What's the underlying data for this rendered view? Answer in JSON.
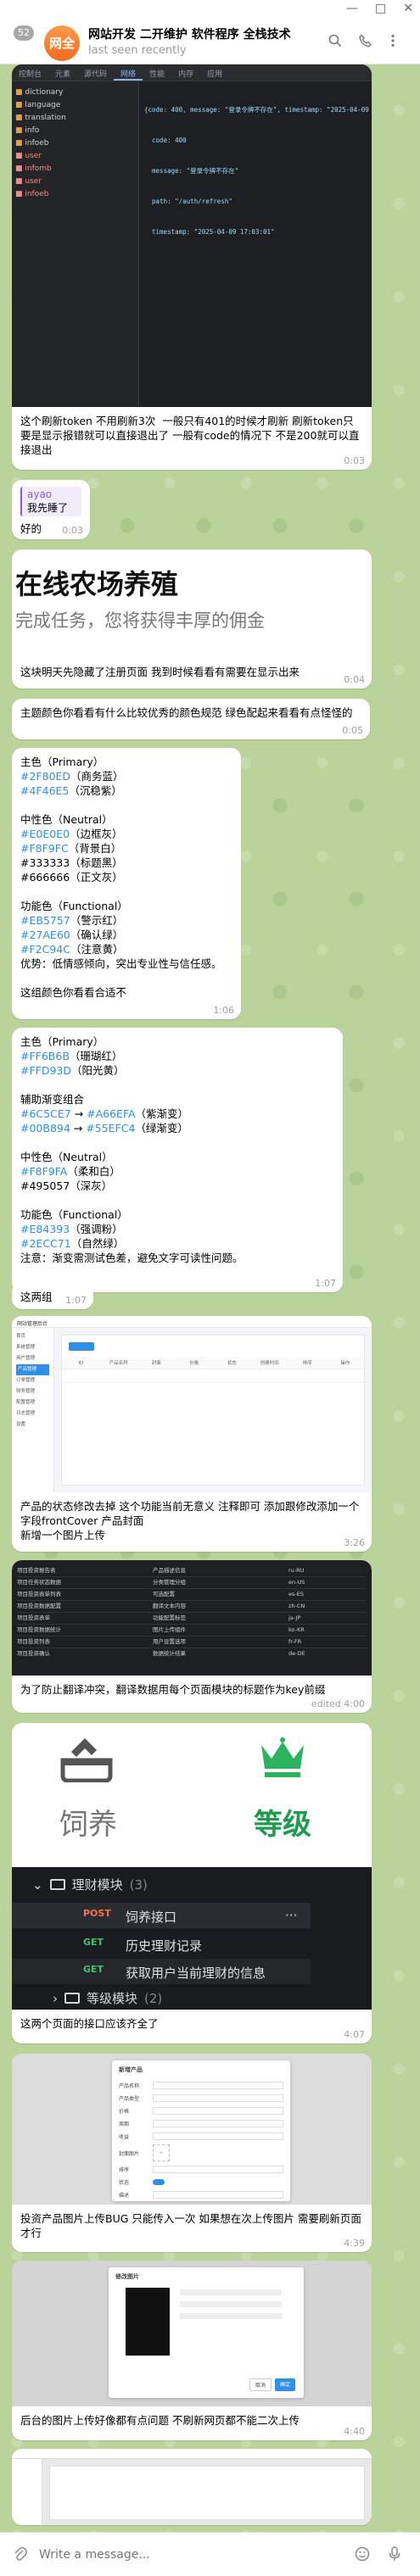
{
  "window": {
    "minimize": "—",
    "maximize": "□",
    "close": "✕"
  },
  "header": {
    "back_count": "52",
    "avatar_text": "网全",
    "title": "网站开发 二开维护 软件程序 全栈技术",
    "status": "last seen recently"
  },
  "shot1": {
    "tabs": [
      "控制台",
      "元素",
      "源代码",
      "网络",
      "性能",
      "内存",
      "应用"
    ],
    "tree": [
      "dictionary",
      "language",
      "translation",
      "info",
      "infoeb",
      "user",
      "infomb",
      "user",
      "infoeb"
    ],
    "json_lines": [
      "{code: 400, message: \"登录令牌不存在\", timestamp: \"2025-04-09 17:03:01\"}",
      "  code: 400",
      "  message: \"登录令牌不存在\"",
      "  path: \"/auth/refresh\"",
      "  timestamp: \"2025-04-09 17:03:01\""
    ]
  },
  "msg1": {
    "text": "这个刷新token 不用刷新3次  一般只有401的时候才刷新 刷新token只要是显示报错就可以直接退出了 一般有code的情况下 不是200就可以直接退出",
    "time": "0:03"
  },
  "msg2": {
    "reply_name": "ayao",
    "reply_text": "我先睡了",
    "text": "好的",
    "time": "0:03"
  },
  "msg3": {
    "headline": "在线农场养殖",
    "sub": "完成任务，您将获得丰厚的佣金",
    "text": "这块明天先隐藏了注册页面 我到时候看看有需要在显示出来",
    "time": "0:04"
  },
  "msg4": {
    "text": "主题颜色你看看有什么比较优秀的颜色规范 绿色配起来看看有点怪怪的",
    "time": "0:05"
  },
  "msg5": {
    "primary_title": "主色（Primary）",
    "primary": [
      {
        "hex": "#2F80ED",
        "label": "（商务蓝）"
      },
      {
        "hex": "#4F46E5",
        "label": "（沉稳紫）"
      }
    ],
    "neutral_title": "中性色（Neutral）",
    "neutral": [
      {
        "hex": "#E0E0E0",
        "label": "（边框灰）"
      },
      {
        "hex": "#F8F9FC",
        "label": "（背景白）"
      },
      {
        "hex": "#333333",
        "label": "（标题黑）"
      },
      {
        "hex": "#666666",
        "label": "（正文灰）"
      }
    ],
    "functional_title": "功能色（Functional）",
    "functional": [
      {
        "hex": "#EB5757",
        "label": "（警示红）"
      },
      {
        "hex": "#27AE60",
        "label": "（确认绿）"
      },
      {
        "hex": "#F2C94C",
        "label": "（注意黄）"
      }
    ],
    "advantage": "优势：低情感倾向，突出专业性与信任感。",
    "closing": "这组颜色你看看合适不",
    "time": "1:06"
  },
  "msg6": {
    "primary_title": "主色（Primary）",
    "primary": [
      {
        "hex": "#FF6B6B",
        "label": "（珊瑚红）"
      },
      {
        "hex": "#FFD93D",
        "label": "（阳光黄）"
      }
    ],
    "gradient_title": "辅助渐变组合",
    "gradients": [
      {
        "from": "#6C5CE7",
        "to": "#A66EFA",
        "label": "（紫渐变）"
      },
      {
        "from": "#00B894",
        "to": "#55EFC4",
        "label": "（绿渐变）"
      }
    ],
    "arrow": " → ",
    "neutral_title": "中性色（Neutral）",
    "neutral": [
      {
        "hex": "#F8F9FA",
        "label": "（柔和白）"
      },
      {
        "hex": "#495057",
        "label": "（深灰）"
      }
    ],
    "functional_title": "功能色（Functional）",
    "functional": [
      {
        "hex": "#E84393",
        "label": "（强调粉）"
      },
      {
        "hex": "#2ECC71",
        "label": "（自然绿）"
      }
    ],
    "note": "注意：渐变需测试色差，避免文字可读性问题。",
    "time": "1:07"
  },
  "msg7": {
    "text": "这两组",
    "time": "1:07"
  },
  "msg8": {
    "app_title": "网站管理后台",
    "side": [
      "首页",
      "系统管理",
      "用户管理",
      "产品管理",
      "订单管理",
      "财务管理",
      "配置管理",
      "日志管理",
      "设置"
    ],
    "cols": [
      "ID",
      "产品名称",
      "封面",
      "价格",
      "状态",
      "创建时间",
      "排序",
      "操作"
    ],
    "text": "产品的状态修改去掉 这个功能当前无意义 注释即可 添加跟修改添加一个字段frontCover 产品封面\n新增一个图片上传",
    "time": "3:26"
  },
  "msg9": {
    "rows": [
      [
        "项目投资报告表",
        "产品描述信息",
        "ru-RU"
      ],
      [
        "项目任务状态数据",
        "分类管理分组",
        "en-US"
      ],
      [
        "项目投资表单列表",
        "可选配置",
        "es-ES"
      ],
      [
        "项目投资数据配置",
        "翻译文本内容",
        "zh-CN"
      ],
      [
        "项目投资表单",
        "功能配置标签",
        "ja-JP"
      ],
      [
        "项目投资数据统计",
        "图片上传组件",
        "ko-KR"
      ],
      [
        "项目投资列表",
        "用户设置选项",
        "fr-FR"
      ],
      [
        "项目投资确认",
        "数据统计结果",
        "de-DE"
      ]
    ],
    "text": "为了防止翻译冲突，翻译数据用每个页面模块的标题作为key前缀",
    "time": "edited 4:00"
  },
  "msg10": {
    "icon1_label": "饲养",
    "icon2_label": "等级",
    "folder1": "理财模块",
    "folder1_count": "(3)",
    "apis": [
      {
        "method": "POST",
        "name": "饲养接口"
      },
      {
        "method": "GET",
        "name": "历史理财记录"
      },
      {
        "method": "GET",
        "name": "获取用户当前理财的信息"
      }
    ],
    "more": "···",
    "folder2": "等级模块",
    "folder2_count": "(2)",
    "text": "这两个页面的接口应该齐全了",
    "time": "4:07"
  },
  "msg11": {
    "form_title": "新增产品",
    "labels": [
      "产品名称",
      "产品类型",
      "价格",
      "周期",
      "收益",
      "封面图片",
      "排序",
      "状态",
      "描述"
    ],
    "text": "投资产品图片上传BUG 只能传入一次 如果想在次上传图片 需要刷新页面才行",
    "time": "4:39"
  },
  "msg12": {
    "dlg_title": "修改图片",
    "ok": "确定",
    "cancel": "取消",
    "text": "后台的图片上传好像都有点问题 不刷新网页都不能二次上传",
    "time": "4:40"
  },
  "input": {
    "placeholder": "Write a message..."
  },
  "colors": {
    "accent": "#2f8ee5",
    "bg": "#b9d39a"
  }
}
